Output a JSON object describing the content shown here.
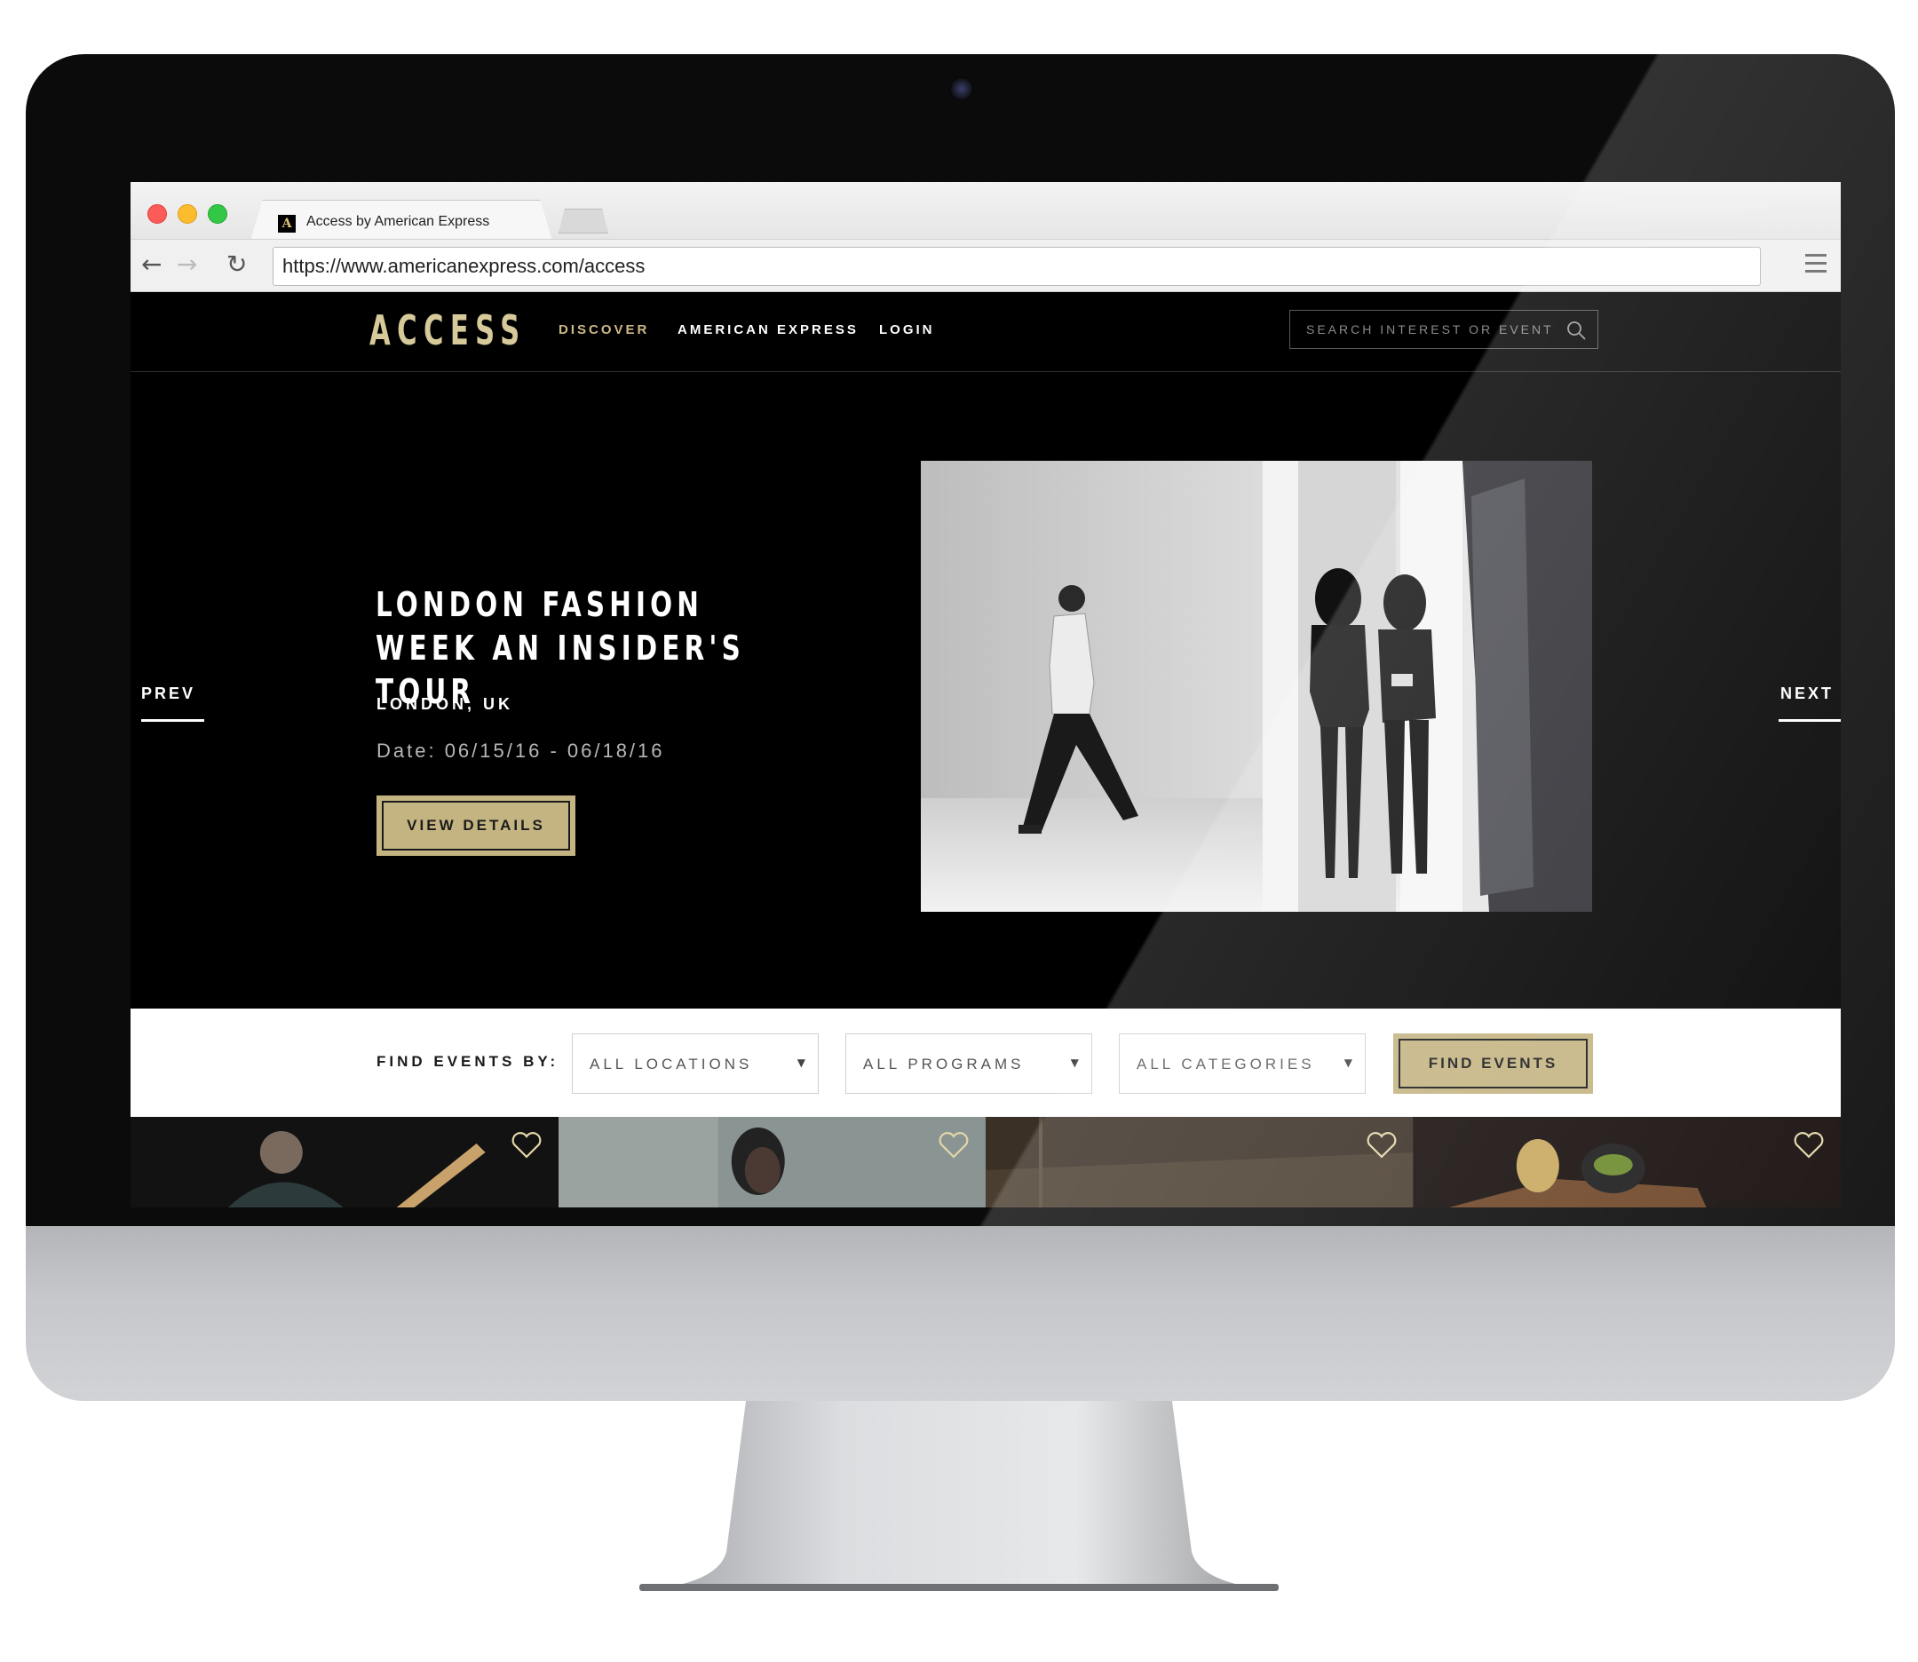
{
  "browser": {
    "tab_title": "Access by American Express",
    "favicon_letter": "A",
    "url": "https://www.americanexpress.com/access"
  },
  "site": {
    "logo": "ACCESS",
    "nav": {
      "discover": "DISCOVER",
      "american_express": "AMERICAN EXPRESS",
      "login": "LOGIN"
    },
    "search": {
      "placeholder": "SEARCH INTEREST OR EVENT",
      "value": "",
      "icon": "search-icon"
    },
    "colors": {
      "accent_gold": "#c4b482",
      "logo_gold": "#d6c99a",
      "background": "#000000"
    }
  },
  "hero": {
    "prev_label": "PREV",
    "next_label": "NEXT",
    "event_title": "LONDON FASHION WEEK AN INSIDER'S TOUR",
    "location": "LONDON, UK",
    "date": "Date: 06/15/16 - 06/18/16",
    "cta_label": "VIEW DETAILS"
  },
  "filters": {
    "label": "FIND EVENTS BY:",
    "locations": {
      "selected": "ALL LOCATIONS"
    },
    "programs": {
      "selected": "ALL PROGRAMS"
    },
    "categories": {
      "selected": "ALL CATEGORIES"
    },
    "submit_label": "FIND EVENTS"
  },
  "cards": [
    {
      "icon": "heart-icon"
    },
    {
      "icon": "heart-icon"
    },
    {
      "icon": "heart-icon"
    },
    {
      "icon": "heart-icon"
    }
  ]
}
